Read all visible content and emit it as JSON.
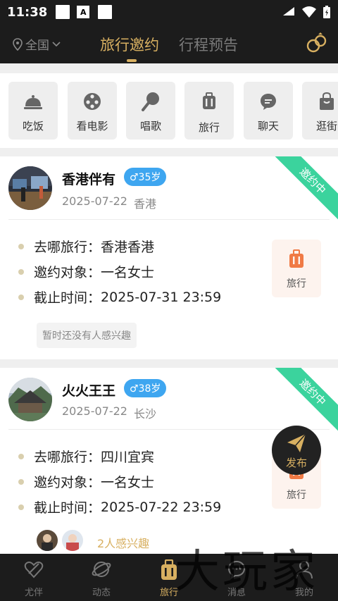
{
  "status_bar": {
    "time": "11:38"
  },
  "header": {
    "location": "全国",
    "tabs": [
      {
        "label": "旅行邀约",
        "active": true
      },
      {
        "label": "行程预告",
        "active": false
      }
    ]
  },
  "categories": [
    {
      "label": "吃饭",
      "icon": "cloche-icon"
    },
    {
      "label": "看电影",
      "icon": "film-reel-icon"
    },
    {
      "label": "唱歌",
      "icon": "microphone-icon"
    },
    {
      "label": "旅行",
      "icon": "luggage-icon"
    },
    {
      "label": "聊天",
      "icon": "chat-bubble-icon"
    },
    {
      "label": "逛街",
      "icon": "shopping-bag-icon"
    }
  ],
  "cards": [
    {
      "name": "香港伴有",
      "gender_age": "♂35岁",
      "date": "2025-07-22",
      "city": "香港",
      "status": "邀约中",
      "details": [
        {
          "label": "去哪旅行：",
          "value": "香港香港"
        },
        {
          "label": "邀约对象：",
          "value": "一名女士"
        },
        {
          "label": "截止时间：",
          "value": "2025-07-31 23:59"
        }
      ],
      "category_label": "旅行",
      "interest_text": "暂时还没有人感兴趣"
    },
    {
      "name": "火火王王",
      "gender_age": "♂38岁",
      "date": "2025-07-22",
      "city": "长沙",
      "status": "邀约中",
      "details": [
        {
          "label": "去哪旅行：",
          "value": "四川宜宾"
        },
        {
          "label": "邀约对象：",
          "value": "一名女士"
        },
        {
          "label": "截止时间：",
          "value": "2025-07-22 23:59"
        }
      ],
      "category_label": "旅行",
      "interest_text": "2人感兴趣"
    }
  ],
  "fab": {
    "label": "发布"
  },
  "bottom_nav": [
    {
      "label": "尤伴",
      "active": false
    },
    {
      "label": "动态",
      "active": false
    },
    {
      "label": "旅行",
      "active": true
    },
    {
      "label": "消息",
      "active": false
    },
    {
      "label": "我的",
      "active": false
    }
  ],
  "watermark": "大玩家",
  "colors": {
    "accent": "#d8b061",
    "ribbon": "#3bd39d",
    "badge": "#3ea6f0",
    "dark": "#1c1c1c",
    "travel_icon": "#f07a45"
  }
}
